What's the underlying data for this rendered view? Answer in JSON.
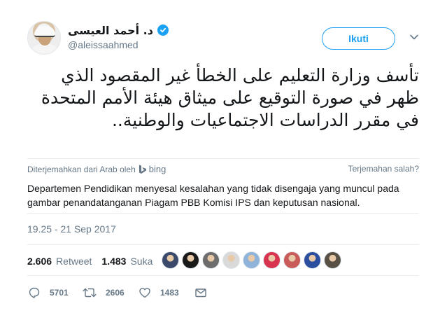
{
  "author": {
    "display_name": "د. أحمد العيسى",
    "handle": "@aleissaahmed",
    "verified": true
  },
  "follow_button": {
    "label": "Ikuti"
  },
  "tweet": {
    "text": "تأسف وزارة التعليم على الخطأ غير المقصود الذي ظهر في صورة التوقيع على ميثاق هيئة الأمم المتحدة في مقرر الدراسات الاجتماعيات والوطنية..",
    "translated_by_label": "Diterjemahkan dari Arab oleh",
    "translator": "bing",
    "wrong_translation_label": "Terjemahan salah?",
    "translation": "Departemen Pendidikan menyesal kesalahan yang tidak disengaja yang muncul pada gambar penandatanganan Piagam PBB Komisi IPS dan keputusan nasional.",
    "timestamp": "19.25 - 21 Sep 2017"
  },
  "stats": {
    "retweets": "2.606",
    "retweets_label": "Retweet",
    "likes": "1.483",
    "likes_label": "Suka"
  },
  "likers": [
    {
      "color": "#3b4a6b"
    },
    {
      "color": "#1a1a1a"
    },
    {
      "color": "#6d6d6d"
    },
    {
      "color": "#d9d9d9"
    },
    {
      "color": "#8fb3d9"
    },
    {
      "color": "#d8344f"
    },
    {
      "color": "#c95b5b"
    },
    {
      "color": "#2b4f9e"
    },
    {
      "color": "#5a5146"
    }
  ],
  "actions": {
    "reply_count": "5701",
    "retweet_count": "2606",
    "like_count": "1483"
  },
  "colors": {
    "accent": "#1da1f2",
    "secondary_text": "#657786",
    "border": "#e6ecf0"
  }
}
